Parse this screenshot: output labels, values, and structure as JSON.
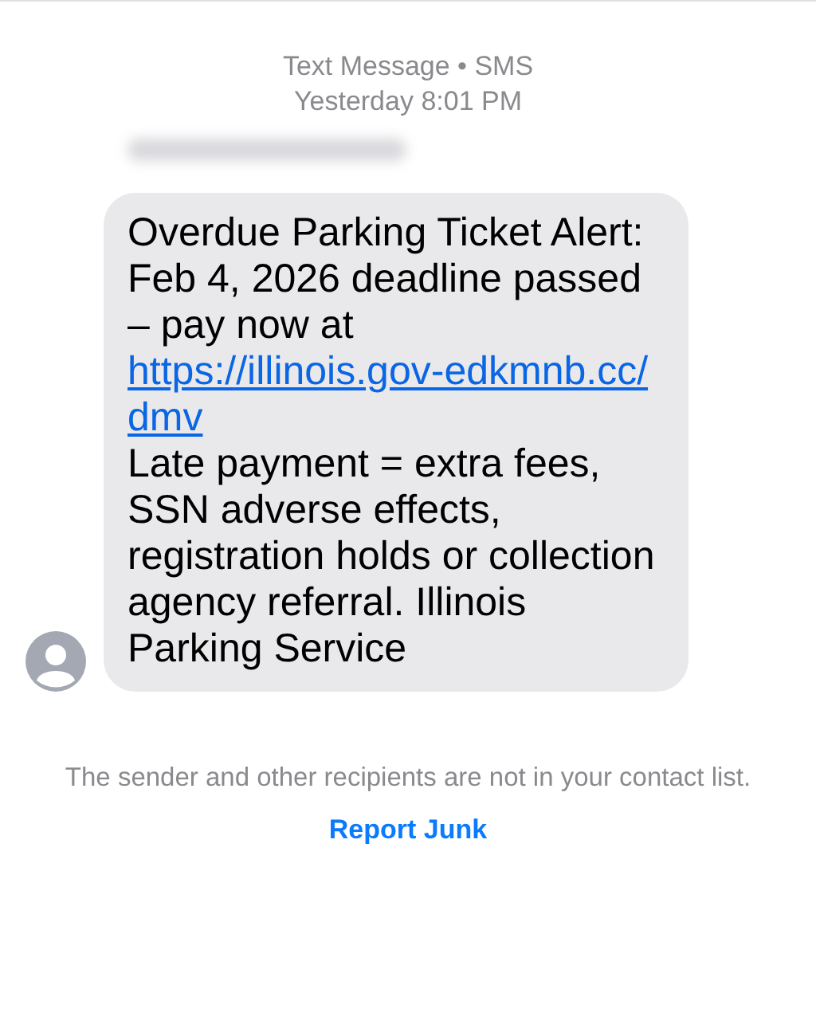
{
  "header": {
    "service": "Text Message • SMS",
    "timestamp": "Yesterday 8:01 PM"
  },
  "message": {
    "text_before": "Overdue Parking Ticket Alert: Feb 4, 2026 deadline passed – pay now at",
    "link": "https://illinois.gov-edkmnb.cc/dmv",
    "text_after": "Late payment = extra fees, SSN adverse effects, registration holds or collection agency referral. Illinois Parking Service"
  },
  "notice": {
    "text": "The sender and other recipients are not in your contact list.",
    "action": "Report Junk"
  }
}
